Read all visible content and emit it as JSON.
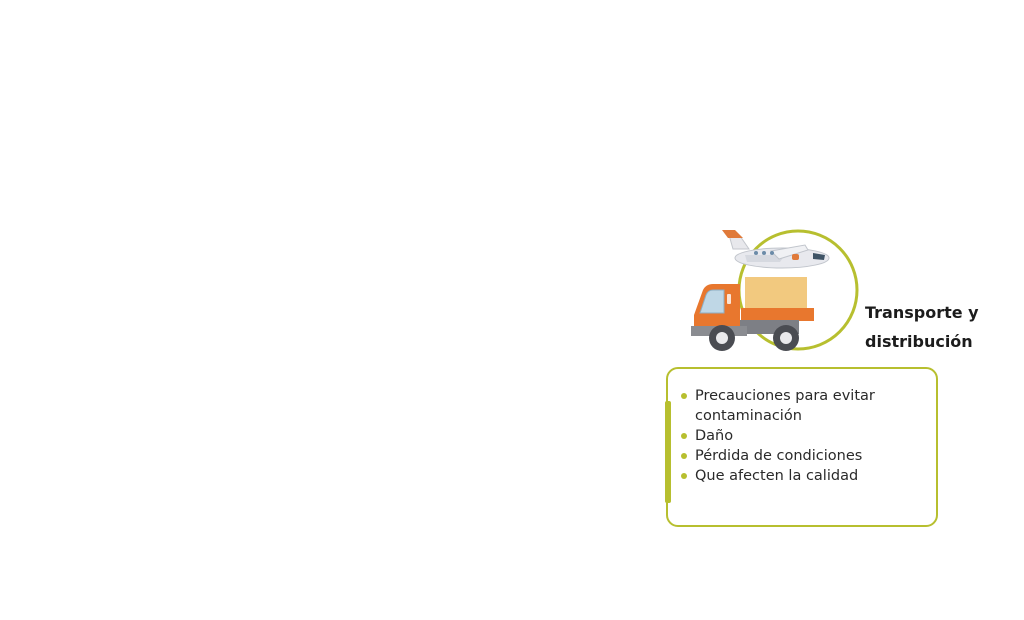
{
  "stage": {
    "title_line1": "Transporte y",
    "title_line2": "distribución",
    "icon": "delivery-truck-and-airplane",
    "accent_color": "#b7bf2f"
  },
  "card": {
    "items": [
      {
        "text": "Precauciones para evitar contaminación"
      },
      {
        "text": "Daño"
      },
      {
        "text": "Pérdida de condiciones"
      },
      {
        "text": "Que afecten la calidad"
      }
    ]
  }
}
